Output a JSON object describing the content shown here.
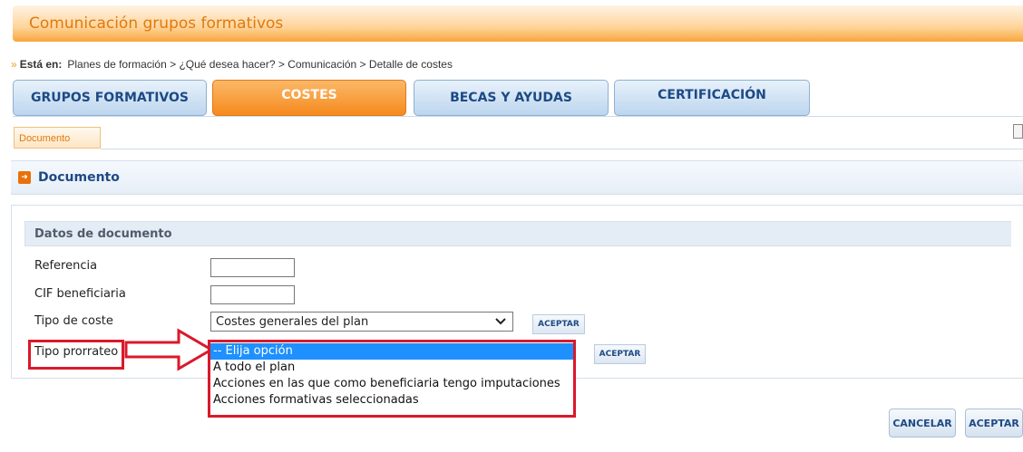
{
  "header": {
    "title": "Comunicación grupos formativos"
  },
  "breadcrumb": {
    "prefix": "»",
    "label": "Está en:",
    "path": "Planes de formación > ¿Qué desea hacer? > Comunicación > Detalle de costes"
  },
  "tabs": [
    {
      "label": "GRUPOS FORMATIVOS",
      "active": false
    },
    {
      "label": "COSTES",
      "active": true
    },
    {
      "label": "BECAS Y AYUDAS",
      "active": false
    },
    {
      "label": "CERTIFICACIÓN",
      "active": false
    }
  ],
  "subtab": {
    "label": "Documento"
  },
  "section": {
    "title": "Documento"
  },
  "form": {
    "panel_title": "Datos de documento",
    "referencia": {
      "label": "Referencia",
      "value": ""
    },
    "cif": {
      "label": "CIF beneficiaria",
      "value": ""
    },
    "tipo_coste": {
      "label": "Tipo de coste",
      "value": "Costes generales del plan",
      "button": "ACEPTAR"
    },
    "tipo_prorrateo": {
      "label": "Tipo prorrateo",
      "button": "ACEPTAR",
      "options": [
        "-- Elija opción",
        "A todo el plan",
        "Acciones en las que como beneficiaria tengo imputaciones",
        "Acciones formativas seleccionadas"
      ],
      "selected_index": 0
    }
  },
  "footer": {
    "cancel_label": "CANCELAR",
    "accept_label": "ACEPTAR"
  },
  "colors": {
    "accent_orange": "#f58a1d",
    "nav_blue": "#1d4a85",
    "highlight_red": "#d9192b",
    "selection_blue": "#1e90ff"
  }
}
